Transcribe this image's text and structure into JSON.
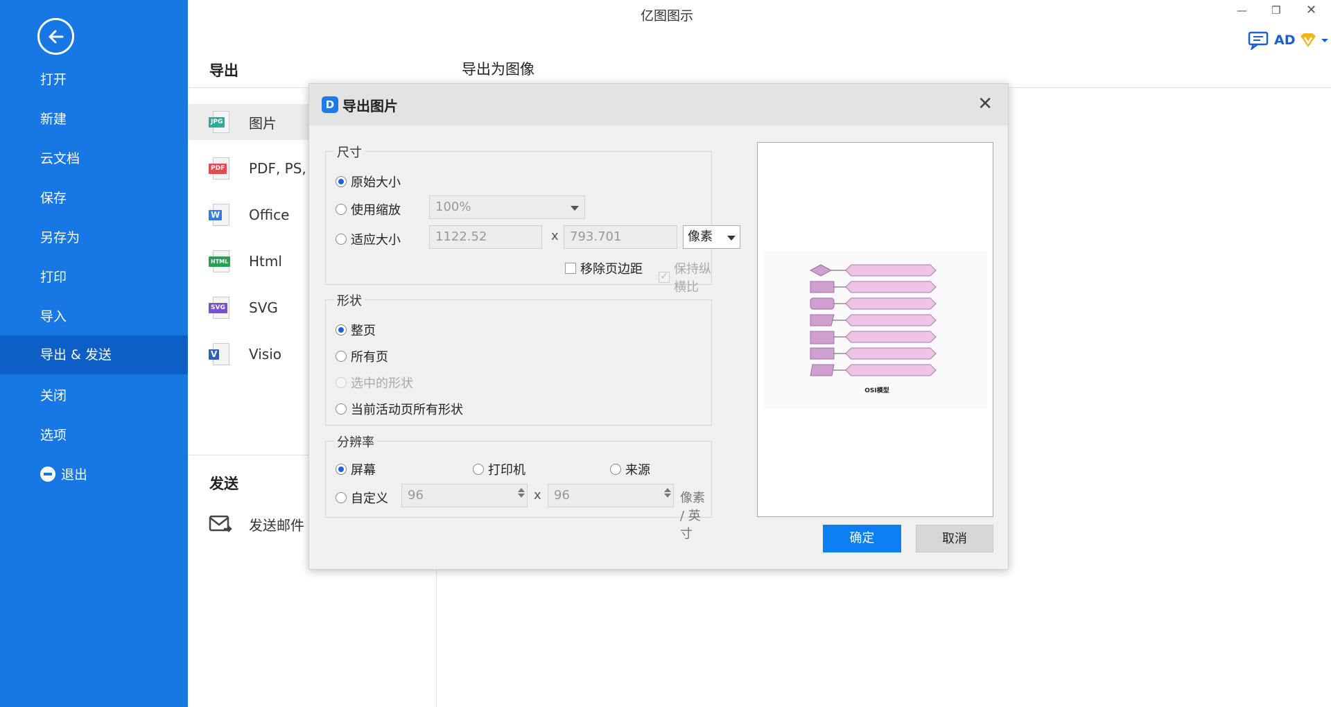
{
  "app": {
    "title": "亿图图示",
    "ad_label": "AD"
  },
  "sidebar": {
    "items": [
      {
        "label": "打开"
      },
      {
        "label": "新建"
      },
      {
        "label": "云文档"
      },
      {
        "label": "保存"
      },
      {
        "label": "另存为"
      },
      {
        "label": "打印"
      },
      {
        "label": "导入"
      },
      {
        "label": "导出 & 发送"
      },
      {
        "label": "关闭"
      },
      {
        "label": "选项"
      },
      {
        "label": "退出"
      }
    ],
    "active": "导出 & 发送"
  },
  "export_panel": {
    "title": "导出",
    "content_title": "导出为图像",
    "formats": [
      {
        "label": "图片",
        "tag": "JPG",
        "color": "#2bab9a"
      },
      {
        "label": "PDF, PS,",
        "tag": "PDF",
        "color": "#e8474c"
      },
      {
        "label": "Office",
        "tag": "W",
        "color": "#2f7de1"
      },
      {
        "label": "Html",
        "tag": "HTML",
        "color": "#2aa055"
      },
      {
        "label": "SVG",
        "tag": "SVG",
        "color": "#7a4fd1"
      },
      {
        "label": "Visio",
        "tag": "V",
        "color": "#2f5fc4"
      }
    ],
    "send_title": "发送",
    "send_email_label": "发送邮件"
  },
  "dialog": {
    "title": "导出图片",
    "size_group": {
      "title": "尺寸",
      "original": "原始大小",
      "use_scale": "使用缩放",
      "scale_value": "100%",
      "fit_size": "适应大小",
      "width_value": "1122.52",
      "x": "x",
      "height_value": "793.701",
      "unit": "像素",
      "remove_margin": "移除页边距",
      "keep_ratio": "保持纵横比"
    },
    "shape_group": {
      "title": "形状",
      "whole_page": "整页",
      "all_pages": "所有页",
      "selected_shapes": "选中的形状",
      "active_page_shapes": "当前活动页所有形状"
    },
    "resolution_group": {
      "title": "分辨率",
      "screen": "屏幕",
      "printer": "打印机",
      "source": "来源",
      "custom": "自定义",
      "dpi_x": "96",
      "x": "x",
      "dpi_y": "96",
      "unit": "像素 / 英寸"
    },
    "preview": {
      "caption": "OSI模型"
    },
    "ok_label": "确定",
    "cancel_label": "取消"
  }
}
